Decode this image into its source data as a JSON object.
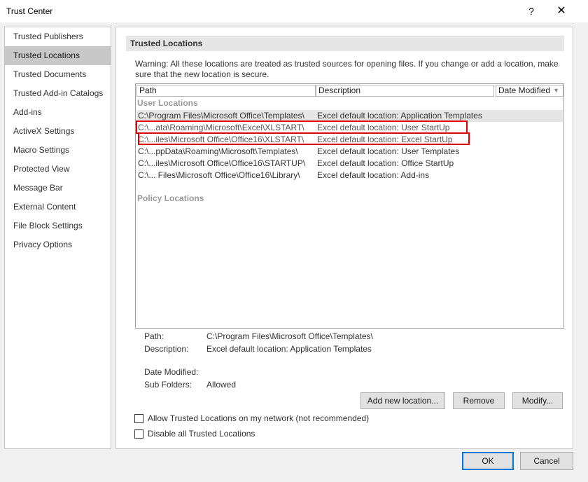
{
  "window": {
    "title": "Trust Center",
    "help_label": "?",
    "close_label": "✕"
  },
  "sidebar": {
    "items": [
      {
        "label": "Trusted Publishers"
      },
      {
        "label": "Trusted Locations"
      },
      {
        "label": "Trusted Documents"
      },
      {
        "label": "Trusted Add-in Catalogs"
      },
      {
        "label": "Add-ins"
      },
      {
        "label": "ActiveX Settings"
      },
      {
        "label": "Macro Settings"
      },
      {
        "label": "Protected View"
      },
      {
        "label": "Message Bar"
      },
      {
        "label": "External Content"
      },
      {
        "label": "File Block Settings"
      },
      {
        "label": "Privacy Options"
      }
    ],
    "active_index": 1
  },
  "main": {
    "section_title": "Trusted Locations",
    "warning": "Warning: All these locations are treated as trusted sources for opening files.  If you change or add a location, make sure that the new location is secure.",
    "table": {
      "columns": [
        "Path",
        "Description",
        "Date Modified"
      ],
      "sort_icon": "▼",
      "user_group_label": "User Locations",
      "policy_group_label": "Policy Locations",
      "rows": [
        {
          "path": "C:\\Program Files\\Microsoft Office\\Templates\\",
          "description": "Excel default location: Application Templates"
        },
        {
          "path": "C:\\...ata\\Roaming\\Microsoft\\Excel\\XLSTART\\",
          "description": "Excel default location: User StartUp"
        },
        {
          "path": "C:\\...iles\\Microsoft Office\\Office16\\XLSTART\\",
          "description": "Excel default location: Excel StartUp"
        },
        {
          "path": "C:\\...ppData\\Roaming\\Microsoft\\Templates\\",
          "description": "Excel default location: User Templates"
        },
        {
          "path": "C:\\...iles\\Microsoft Office\\Office16\\STARTUP\\",
          "description": "Excel default location: Office StartUp"
        },
        {
          "path": "C:\\... Files\\Microsoft Office\\Office16\\Library\\",
          "description": "Excel default location: Add-ins"
        }
      ]
    },
    "details": {
      "path_label": "Path:",
      "path_value": "C:\\Program Files\\Microsoft Office\\Templates\\",
      "description_label": "Description:",
      "description_value": "Excel default location: Application Templates",
      "date_modified_label": "Date Modified:",
      "date_modified_value": "",
      "sub_folders_label": "Sub Folders:",
      "sub_folders_value": "Allowed"
    },
    "buttons": {
      "add_new": "Add new location...",
      "remove": "Remove",
      "modify": "Modify..."
    },
    "checkboxes": {
      "allow_network": {
        "label": "Allow Trusted Locations on my network (not recommended)",
        "checked": false
      },
      "disable_all": {
        "label": "Disable all Trusted Locations",
        "checked": false
      }
    }
  },
  "footer": {
    "ok": "OK",
    "cancel": "Cancel"
  },
  "colors": {
    "highlight_border": "#e00000",
    "active_item_bg": "#c8c8c8",
    "ok_border": "#0078d7"
  }
}
